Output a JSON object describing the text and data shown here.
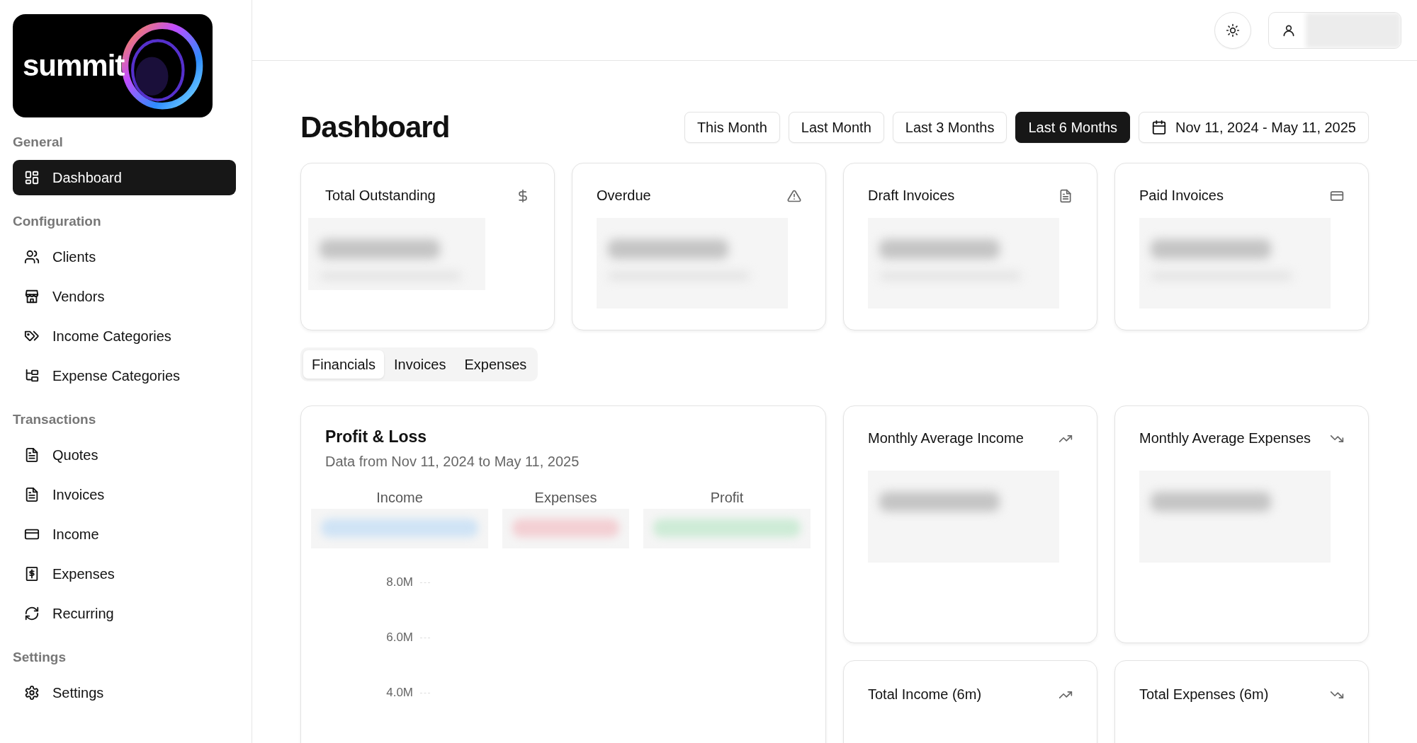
{
  "logo": {
    "text": "summit"
  },
  "sidebar": {
    "sections": [
      {
        "title": "General",
        "items": [
          {
            "label": "Dashboard",
            "selected": true
          }
        ]
      },
      {
        "title": "Configuration",
        "items": [
          {
            "label": "Clients",
            "selected": false
          },
          {
            "label": "Vendors",
            "selected": false
          },
          {
            "label": "Income Categories",
            "selected": false
          },
          {
            "label": "Expense Categories",
            "selected": false
          }
        ]
      },
      {
        "title": "Transactions",
        "items": [
          {
            "label": "Quotes",
            "selected": false
          },
          {
            "label": "Invoices",
            "selected": false
          },
          {
            "label": "Income",
            "selected": false
          },
          {
            "label": "Expenses",
            "selected": false
          },
          {
            "label": "Recurring",
            "selected": false
          }
        ]
      },
      {
        "title": "Settings",
        "items": [
          {
            "label": "Settings",
            "selected": false
          }
        ]
      }
    ]
  },
  "page": {
    "title": "Dashboard",
    "ranges": [
      {
        "label": "This Month",
        "selected": false
      },
      {
        "label": "Last Month",
        "selected": false
      },
      {
        "label": "Last 3 Months",
        "selected": false
      },
      {
        "label": "Last 6 Months",
        "selected": true
      }
    ],
    "date_range": "Nov 11, 2024 - May 11, 2025"
  },
  "stat_cards": [
    {
      "title": "Total Outstanding"
    },
    {
      "title": "Overdue"
    },
    {
      "title": "Draft Invoices"
    },
    {
      "title": "Paid Invoices"
    }
  ],
  "tabs": [
    {
      "label": "Financials",
      "selected": true
    },
    {
      "label": "Invoices",
      "selected": false
    },
    {
      "label": "Expenses",
      "selected": false
    }
  ],
  "profit_loss": {
    "title": "Profit & Loss",
    "subtitle": "Data from Nov 11, 2024 to May 11, 2025",
    "legend": [
      {
        "label": "Income",
        "color": "#cfe3f5"
      },
      {
        "label": "Expenses",
        "color": "#f3cfd3"
      },
      {
        "label": "Profit",
        "color": "#cdebd6"
      }
    ],
    "y_ticks": [
      "8.0M",
      "6.0M",
      "4.0M"
    ]
  },
  "metric_cards": [
    {
      "title": "Monthly Average Income"
    },
    {
      "title": "Monthly Average Expenses"
    },
    {
      "title": "Total Income (6m)"
    },
    {
      "title": "Total Expenses (6m)"
    }
  ]
}
